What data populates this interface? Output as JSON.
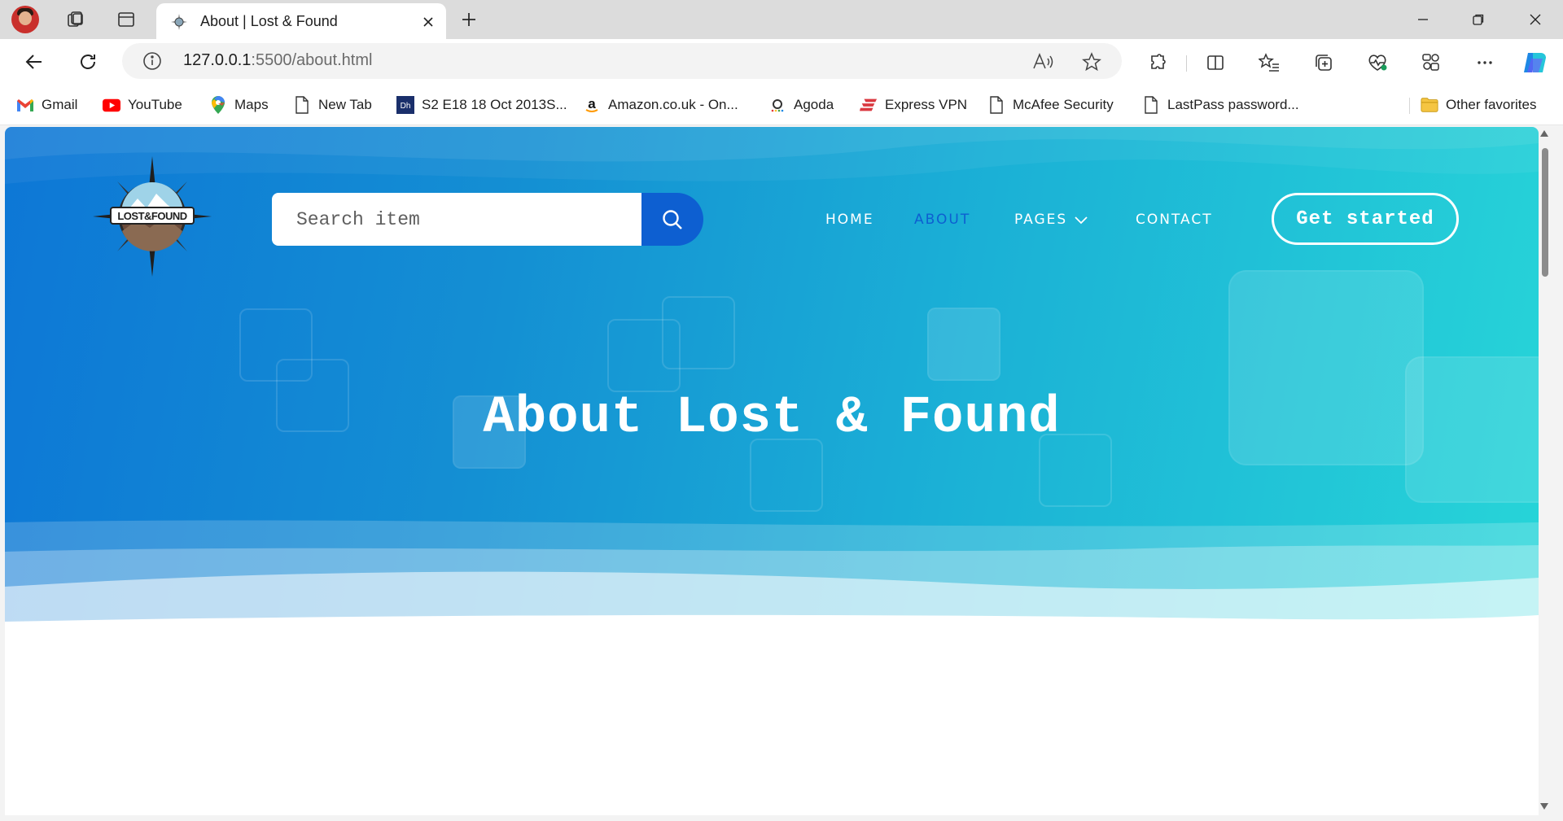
{
  "browser": {
    "tab_title": "About | Lost & Found",
    "url_host": "127.0.0.1",
    "url_path": ":5500/about.html",
    "bookmarks": [
      {
        "label": "Gmail",
        "icon": "gmail-icon"
      },
      {
        "label": "YouTube",
        "icon": "youtube-icon"
      },
      {
        "label": "Maps",
        "icon": "maps-icon"
      },
      {
        "label": "New Tab",
        "icon": "page-icon"
      },
      {
        "label": "S2 E18 18 Oct 2013S...",
        "icon": "dh-icon"
      },
      {
        "label": "Amazon.co.uk - On...",
        "icon": "amazon-icon"
      },
      {
        "label": "Agoda",
        "icon": "agoda-icon"
      },
      {
        "label": "Express VPN",
        "icon": "expressvpn-icon"
      },
      {
        "label": "McAfee Security",
        "icon": "page-icon"
      },
      {
        "label": "LastPass password...",
        "icon": "page-icon"
      }
    ],
    "other_favorites": "Other favorites"
  },
  "site": {
    "logo_text": "LOST&FOUND",
    "search_placeholder": "Search item",
    "nav": {
      "home": "HOME",
      "about": "ABOUT",
      "pages": "PAGES",
      "contact": "CONTACT"
    },
    "active_nav": "about",
    "cta_label": "Get started",
    "hero_title": "About Lost & Found"
  },
  "colors": {
    "hero_start": "#0d77d6",
    "hero_end": "#27d5d8",
    "accent": "#0d5fd1"
  }
}
